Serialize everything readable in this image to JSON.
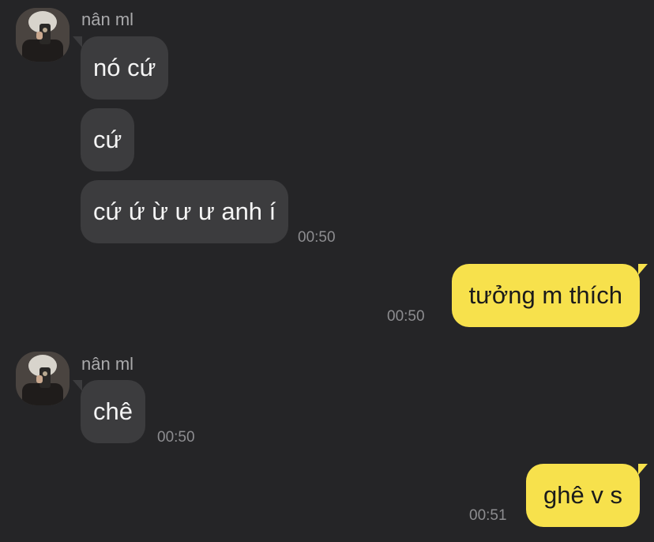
{
  "chat": {
    "groups": [
      {
        "sender": "nân ml",
        "messages": [
          "nó cứ",
          "cứ",
          "cứ ứ ừ ư ư anh í"
        ],
        "time": "00:50"
      },
      {
        "outgoing": "tưởng m thích",
        "time": "00:50"
      },
      {
        "sender": "nân ml",
        "messages": [
          "chê"
        ],
        "time": "00:50"
      },
      {
        "outgoing": "ghê v s",
        "time": "00:51"
      }
    ]
  },
  "colors": {
    "background": "#252527",
    "incoming_bubble": "#3c3c3e",
    "outgoing_bubble": "#f7e14c",
    "timestamp": "#8d8d90"
  }
}
